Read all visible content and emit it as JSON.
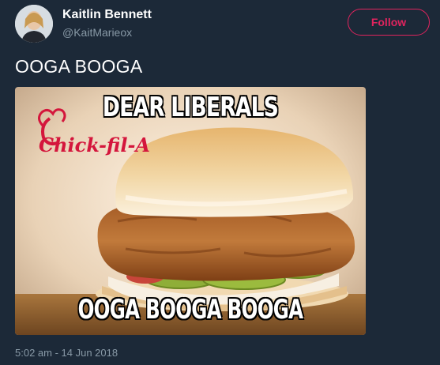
{
  "author": {
    "name": "Kaitlin Bennett",
    "handle": "@KaitMarieox"
  },
  "follow_button": {
    "label": "Follow"
  },
  "tweet": {
    "text": "OOGA BOOGA",
    "timestamp": "5:02 am - 14 Jun 2018"
  },
  "meme": {
    "top_caption": "DEAR LIBERALS",
    "bottom_caption": "OOGA BOOGA BOOGA",
    "logo_text": "Chick-fil-A"
  },
  "colors": {
    "background": "#1c2938",
    "follow_accent": "#e0245e",
    "secondary_text": "#8899a6"
  }
}
